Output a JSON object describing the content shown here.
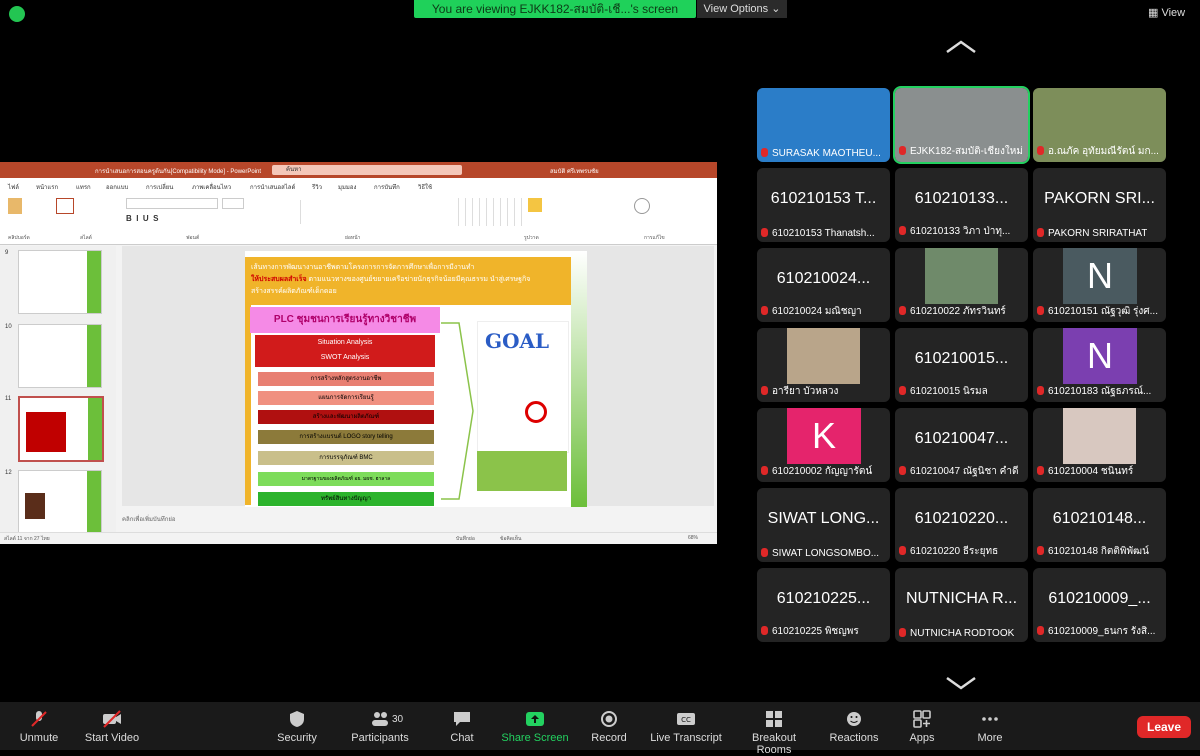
{
  "banner": {
    "text": "You are viewing EJKK182-สมบัติ-เชี...'s screen",
    "view_options": "View Options",
    "view": "View"
  },
  "ppt": {
    "title": "การนำเสนอการสอนครูต้นกัน[Compatibility Mode] - PowerPoint",
    "search": "ค้นหา",
    "user": "สมบัติ ศรีเทพรบชัย",
    "tabs": [
      "ไฟล์",
      "หน้าแรก",
      "แทรก",
      "ออกแบบ",
      "การเปลี่ยน",
      "ภาพเคลื่อนไหว",
      "การนำเสนอสไลด์",
      "รีวิว",
      "มุมมอง",
      "การบันทึก",
      "วิธีใช้"
    ],
    "ribbon_groups": [
      "คลิปบอร์ด",
      "สไลด์",
      "ฟอนต์",
      "ย่อหน้า",
      "รูปวาด",
      "การแก้ไข"
    ],
    "slide_numbers": [
      "9",
      "10",
      "11",
      "12"
    ],
    "notes_placeholder": "คลิกเพื่อเพิ่มบันทึกย่อ",
    "status_left": "สไลด์ 11 จาก 27   ไทย",
    "status_notes": "บันทึกย่อ",
    "status_comments": "ข้อคิดเห็น",
    "zoom": "68%",
    "slide": {
      "header_line1": "เส้นทางการพัฒนางานอาชีพตามโครงการการจัดการศึกษาเพื่อการมีงานทำ",
      "header_line2_red": "ให้ประสบผลสำเร็จ",
      "header_line2_rest": " ตามแนวทางของศูนย์ขยายเครือข่ายนักธุรกิจน้อยมีคุณธรรม นำสู่เศรษฐกิจ",
      "header_line3": "สร้างสรรค์ผลิตภัณฑ์เด็กดอย",
      "plc_title": "PLC ชุมชนการเรียนรู้ทางวิชาชีพ",
      "steps": [
        "Situation Analysis",
        "SWOT Analysis",
        "การสร้างหลักสูตรงานอาชีพ",
        "แผนการจัดการเรียนรู้",
        "สร้างและพัฒนาผลิตภัณฑ์",
        "การสร้างแบรนด์    LOGO  story telling",
        "การบรรจุภัณฑ์ BMC",
        "มาตรฐานของผลิตภัณฑ์  อย.  มผช. ฮาลาล",
        "ทรัพย์สินทางปัญญา"
      ],
      "goal": "GOAL"
    }
  },
  "participants": [
    {
      "big": "",
      "cap": "SURASAK MAOTHEU...",
      "kind": "video",
      "color": "#2b7dc8"
    },
    {
      "big": "",
      "cap": "EJKK182-สมบัติ-เชียงใหม่",
      "kind": "video",
      "color": "#8a8f8f",
      "active": true
    },
    {
      "big": "",
      "cap": "อ.ณภัค อุทัยมณีรัตน์ มก...",
      "kind": "video",
      "color": "#7d8e5a"
    },
    {
      "big": "610210153 T...",
      "cap": "610210153 Thanatsh..."
    },
    {
      "big": "610210133...",
      "cap": "610210133 วิภา ป่าทุ..."
    },
    {
      "big": "PAKORN SRI...",
      "cap": "PAKORN SRIRATHAT"
    },
    {
      "big": "610210024...",
      "cap": "610210024 มณิชญา"
    },
    {
      "big": "",
      "cap": "610210022 ภัทรวินทร์",
      "kind": "video",
      "color": "#6f8a6a"
    },
    {
      "big": "N",
      "cap": "610210151 ณัฐวุฒิ รุ่งศ...",
      "kind": "avatar",
      "color": "#4a5a60"
    },
    {
      "big": "",
      "cap": "อารียา บัวหลวง",
      "kind": "video",
      "color": "#b9a58a"
    },
    {
      "big": "610210015...",
      "cap": "610210015 นิรมล"
    },
    {
      "big": "N",
      "cap": "610210183 ณัฐธภรณ์...",
      "kind": "avatar",
      "color": "#7b3fb0"
    },
    {
      "big": "K",
      "cap": "610210002 กัญญารัตน์",
      "kind": "avatar",
      "color": "#e5246c"
    },
    {
      "big": "610210047...",
      "cap": "610210047 ณัฐนิชา คำดี"
    },
    {
      "big": "",
      "cap": "610210004 ชนินทร์",
      "kind": "video",
      "color": "#d8c8c0"
    },
    {
      "big": "SIWAT LONG...",
      "cap": "SIWAT LONGSOMBO..."
    },
    {
      "big": "610210220...",
      "cap": "610210220 ธีระยุทธ"
    },
    {
      "big": "610210148...",
      "cap": "610210148 กิตติพิพัฒน์"
    },
    {
      "big": "610210225...",
      "cap": "610210225 พิชญพร"
    },
    {
      "big": "NUTNICHA R...",
      "cap": "NUTNICHA RODTOOK"
    },
    {
      "big": "610210009_...",
      "cap": "610210009_ธนกร รังสิ..."
    }
  ],
  "toolbar": {
    "unmute": "Unmute",
    "start_video": "Start Video",
    "security": "Security",
    "participants": "Participants",
    "participants_count": "30",
    "chat": "Chat",
    "share_screen": "Share Screen",
    "record": "Record",
    "live_transcript": "Live Transcript",
    "breakout_rooms": "Breakout Rooms",
    "reactions": "Reactions",
    "apps": "Apps",
    "more": "More",
    "leave": "Leave"
  },
  "colors": {
    "accent_green": "#1fd15a",
    "leave_red": "#e02828",
    "ppt_brand": "#b7472a"
  }
}
